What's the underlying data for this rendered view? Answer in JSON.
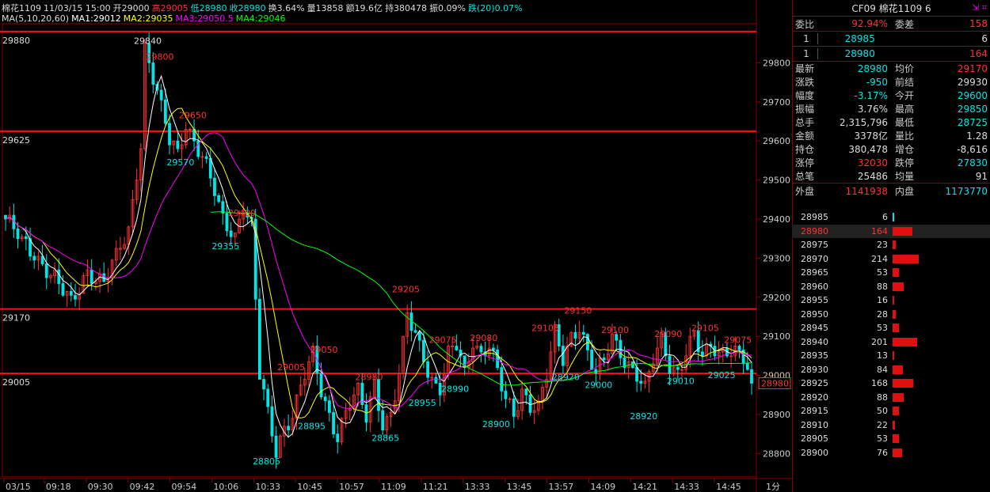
{
  "header": {
    "items": [
      {
        "text": "棉花1109",
        "color": "#dddddd"
      },
      {
        "text": "11/03/15 15:00",
        "color": "#dddddd"
      },
      {
        "text": "开29000",
        "color": "#dddddd"
      },
      {
        "text": "高29005",
        "color": "#ff3232"
      },
      {
        "text": "低28980",
        "color": "#00e5e5"
      },
      {
        "text": "收28980",
        "color": "#00e5e5"
      },
      {
        "text": "换3.64%",
        "color": "#dddddd"
      },
      {
        "text": "量13858",
        "color": "#dddddd"
      },
      {
        "text": "额19.6亿",
        "color": "#dddddd"
      },
      {
        "text": "持380478",
        "color": "#dddddd"
      },
      {
        "text": "振0.09%",
        "color": "#dddddd"
      },
      {
        "text": "跌(20)0.07%",
        "color": "#00e5e5"
      }
    ],
    "ma": [
      {
        "text": "MA(5,10,20,60)",
        "color": "#dddddd"
      },
      {
        "text": "MA1:29012",
        "color": "#ffffff"
      },
      {
        "text": "MA2:29035",
        "color": "#ffff00"
      },
      {
        "text": "MA3:29050.5",
        "color": "#ff00ff"
      },
      {
        "text": "MA4:29046",
        "color": "#00ff00"
      }
    ]
  },
  "chart_data": {
    "type": "candlestick",
    "symbol": "棉花1109",
    "period": "1分",
    "ylim": [
      28740,
      29900
    ],
    "y_ticks": [
      28800,
      28900,
      29000,
      29100,
      29200,
      29300,
      29400,
      29500,
      29600,
      29700,
      29800
    ],
    "x_ticks": [
      "03/15",
      "09:18",
      "09:30",
      "09:42",
      "09:54",
      "10:06",
      "10:33",
      "10:45",
      "10:57",
      "11:09",
      "11:21",
      "13:33",
      "13:45",
      "13:57",
      "14:09",
      "14:21",
      "14:33",
      "14:45"
    ],
    "h_lines": [
      29880,
      29625,
      29170,
      29005
    ],
    "last_price": 28980,
    "colors": {
      "up": "#ff3232",
      "down": "#00e5e5",
      "ma1": "#ffffff",
      "ma2": "#ffff00",
      "ma3": "#ff00ff",
      "ma4": "#00ff00",
      "hline": "#ff1010"
    },
    "anchors": [
      [
        0,
        29400
      ],
      [
        4,
        29340
      ],
      [
        8,
        29300
      ],
      [
        12,
        29250
      ],
      [
        16,
        29180
      ],
      [
        20,
        29270
      ],
      [
        24,
        29240
      ],
      [
        27,
        29300
      ],
      [
        30,
        29370
      ],
      [
        33,
        29600
      ],
      [
        34,
        29840
      ],
      [
        36,
        29760
      ],
      [
        38,
        29680
      ],
      [
        40,
        29600
      ],
      [
        42,
        29570
      ],
      [
        44,
        29650
      ],
      [
        46,
        29600
      ],
      [
        48,
        29560
      ],
      [
        50,
        29500
      ],
      [
        53,
        29400
      ],
      [
        56,
        29360
      ],
      [
        58,
        29440
      ],
      [
        60,
        29380
      ],
      [
        62,
        29000
      ],
      [
        64,
        28900
      ],
      [
        66,
        28810
      ],
      [
        68,
        28870
      ],
      [
        70,
        28900
      ],
      [
        73,
        29000
      ],
      [
        75,
        29050
      ],
      [
        77,
        28960
      ],
      [
        79,
        28900
      ],
      [
        81,
        28850
      ],
      [
        84,
        28930
      ],
      [
        86,
        28950
      ],
      [
        88,
        28890
      ],
      [
        90,
        28980
      ],
      [
        92,
        28880
      ],
      [
        94,
        28900
      ],
      [
        96,
        29000
      ],
      [
        98,
        29150
      ],
      [
        100,
        29100
      ],
      [
        102,
        29050
      ],
      [
        104,
        28990
      ],
      [
        106,
        28970
      ],
      [
        108,
        29050
      ],
      [
        110,
        29075
      ],
      [
        112,
        29000
      ],
      [
        114,
        29090
      ],
      [
        116,
        29060
      ],
      [
        118,
        29080
      ],
      [
        120,
        29010
      ],
      [
        122,
        28930
      ],
      [
        124,
        28900
      ],
      [
        126,
        28960
      ],
      [
        128,
        28930
      ],
      [
        130,
        28920
      ],
      [
        132,
        29000
      ],
      [
        134,
        29105
      ],
      [
        136,
        29040
      ],
      [
        138,
        29100
      ],
      [
        140,
        29130
      ],
      [
        142,
        29060
      ],
      [
        144,
        29000
      ],
      [
        146,
        29030
      ],
      [
        148,
        29100
      ],
      [
        150,
        29060
      ],
      [
        152,
        29030
      ],
      [
        154,
        29000
      ],
      [
        156,
        28960
      ],
      [
        158,
        29040
      ],
      [
        160,
        29090
      ],
      [
        162,
        29030
      ],
      [
        164,
        29010
      ],
      [
        166,
        29060
      ],
      [
        168,
        29100
      ],
      [
        170,
        29040
      ],
      [
        172,
        29080
      ],
      [
        174,
        29060
      ],
      [
        176,
        29070
      ],
      [
        178,
        29060
      ],
      [
        180,
        29040
      ],
      [
        182,
        28980
      ]
    ],
    "n_bars": 183,
    "ma_periods": [
      5,
      10,
      20,
      60
    ],
    "annotations": [
      {
        "text": "29840",
        "x": 34,
        "y": 29840,
        "color": "#dddddd"
      },
      {
        "text": "29800",
        "x": 37,
        "y": 29800,
        "color": "#ff3232"
      },
      {
        "text": "29650",
        "x": 45,
        "y": 29650,
        "color": "#ff3232"
      },
      {
        "text": "29570",
        "x": 42,
        "y": 29570,
        "color": "#00e5e5"
      },
      {
        "text": "29400",
        "x": 57,
        "y": 29400,
        "color": "#ff3232"
      },
      {
        "text": "29355",
        "x": 53,
        "y": 29355,
        "color": "#00e5e5"
      },
      {
        "text": "29050",
        "x": 77,
        "y": 29050,
        "color": "#ff3232"
      },
      {
        "text": "29005",
        "x": 69,
        "y": 29005,
        "color": "#ff3232"
      },
      {
        "text": "28805",
        "x": 63,
        "y": 28805,
        "color": "#00e5e5"
      },
      {
        "text": "28895",
        "x": 74,
        "y": 28895,
        "color": "#00e5e5"
      },
      {
        "text": "28980",
        "x": 88,
        "y": 28980,
        "color": "#ff3232"
      },
      {
        "text": "28865",
        "x": 92,
        "y": 28865,
        "color": "#00e5e5"
      },
      {
        "text": "29205",
        "x": 97,
        "y": 29205,
        "color": "#ff3232"
      },
      {
        "text": "28955",
        "x": 101,
        "y": 28955,
        "color": "#00e5e5"
      },
      {
        "text": "29075",
        "x": 106,
        "y": 29075,
        "color": "#ff3232"
      },
      {
        "text": "28990",
        "x": 109,
        "y": 28990,
        "color": "#00e5e5"
      },
      {
        "text": "29080",
        "x": 116,
        "y": 29080,
        "color": "#ff3232"
      },
      {
        "text": "28900",
        "x": 119,
        "y": 28900,
        "color": "#00e5e5"
      },
      {
        "text": "29105",
        "x": 131,
        "y": 29105,
        "color": "#ff3232"
      },
      {
        "text": "28920",
        "x": 136,
        "y": 29020,
        "color": "#00e5e5"
      },
      {
        "text": "29150",
        "x": 139,
        "y": 29150,
        "color": "#ff3232"
      },
      {
        "text": "29000",
        "x": 144,
        "y": 29000,
        "color": "#00e5e5"
      },
      {
        "text": "29100",
        "x": 148,
        "y": 29100,
        "color": "#ff3232"
      },
      {
        "text": "28920",
        "x": 155,
        "y": 28920,
        "color": "#00e5e5"
      },
      {
        "text": "29090",
        "x": 161,
        "y": 29090,
        "color": "#ff3232"
      },
      {
        "text": "29010",
        "x": 164,
        "y": 29010,
        "color": "#00e5e5"
      },
      {
        "text": "29105",
        "x": 170,
        "y": 29105,
        "color": "#ff3232"
      },
      {
        "text": "29025",
        "x": 174,
        "y": 29025,
        "color": "#00e5e5"
      },
      {
        "text": "29075",
        "x": 178,
        "y": 29075,
        "color": "#ff3232"
      }
    ]
  },
  "panel": {
    "title": "CF09  棉花1109  6",
    "webi": {
      "label": "委比",
      "value": "92.94%",
      "label2": "委差",
      "value2": "158"
    },
    "sell": {
      "label": "1",
      "price": "28985",
      "vol": "6"
    },
    "buy": {
      "label": "1",
      "price": "28980",
      "vol": "164"
    },
    "stats": [
      {
        "l1": "最新",
        "v1": "28980",
        "c1": "g",
        "l2": "均价",
        "v2": "29170",
        "c2": "r"
      },
      {
        "l1": "涨跌",
        "v1": "-950",
        "c1": "g",
        "l2": "前结",
        "v2": "29930",
        "c2": "w"
      },
      {
        "l1": "幅度",
        "v1": "-3.17%",
        "c1": "g",
        "l2": "今开",
        "v2": "29600",
        "c2": "g"
      },
      {
        "l1": "振幅",
        "v1": "3.76%",
        "c1": "w",
        "l2": "最高",
        "v2": "29850",
        "c2": "g"
      },
      {
        "l1": "总手",
        "v1": "2,315,796",
        "c1": "w",
        "l2": "最低",
        "v2": "28725",
        "c2": "g"
      },
      {
        "l1": "金额",
        "v1": "3378亿",
        "c1": "w",
        "l2": "量比",
        "v2": "1.28",
        "c2": "w"
      },
      {
        "l1": "持仓",
        "v1": "380,478",
        "c1": "w",
        "l2": "增仓",
        "v2": "-8,616",
        "c2": "w"
      },
      {
        "l1": "涨停",
        "v1": "32030",
        "c1": "r",
        "l2": "跌停",
        "v2": "27830",
        "c2": "g"
      },
      {
        "l1": "总笔",
        "v1": "25486",
        "c1": "w",
        "l2": "均量",
        "v2": "91",
        "c2": "w"
      }
    ],
    "waipan": {
      "label": "外盘",
      "value": "1141938",
      "label2": "内盘",
      "value2": "1173770"
    },
    "depth": [
      {
        "price": "28985",
        "vol": "6",
        "max": 214,
        "v": 6,
        "color": "g"
      },
      {
        "price": "28980",
        "vol": "164",
        "max": 214,
        "v": 164,
        "color": "r",
        "hl": true
      },
      {
        "price": "28975",
        "vol": "23",
        "v": 23
      },
      {
        "price": "28970",
        "vol": "214",
        "v": 214
      },
      {
        "price": "28965",
        "vol": "53",
        "v": 53
      },
      {
        "price": "28960",
        "vol": "88",
        "v": 88
      },
      {
        "price": "28955",
        "vol": "16",
        "v": 16
      },
      {
        "price": "28950",
        "vol": "28",
        "v": 28
      },
      {
        "price": "28945",
        "vol": "53",
        "v": 53
      },
      {
        "price": "28940",
        "vol": "201",
        "v": 201
      },
      {
        "price": "28935",
        "vol": "13",
        "v": 13
      },
      {
        "price": "28930",
        "vol": "84",
        "v": 84
      },
      {
        "price": "28925",
        "vol": "168",
        "v": 168
      },
      {
        "price": "28920",
        "vol": "88",
        "v": 88
      },
      {
        "price": "28915",
        "vol": "50",
        "v": 50
      },
      {
        "price": "28910",
        "vol": "22",
        "v": 22
      },
      {
        "price": "28905",
        "vol": "53",
        "v": 53
      },
      {
        "price": "28900",
        "vol": "76",
        "v": 76
      }
    ]
  }
}
